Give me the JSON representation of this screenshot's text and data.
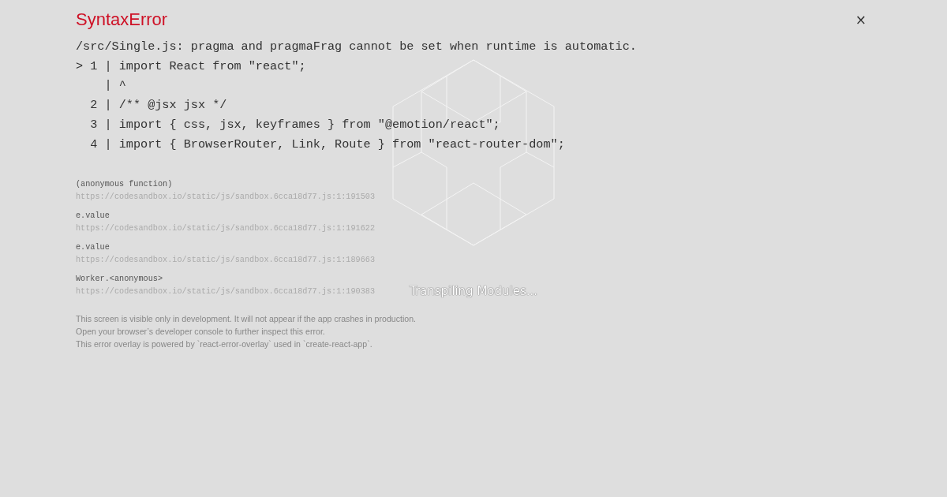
{
  "loader": {
    "status": "Transpiling Modules..."
  },
  "error": {
    "title": "SyntaxError",
    "close": "×",
    "message": "/src/Single.js: pragma and pragmaFrag cannot be set when runtime is automatic.",
    "code_lines": [
      "> 1 | import React from \"react\";",
      "    | ^",
      "  2 | /** @jsx jsx */",
      "  3 | import { css, jsx, keyframes } from \"@emotion/react\";",
      "  4 | import { BrowserRouter, Link, Route } from \"react-router-dom\";"
    ]
  },
  "stack_frames": [
    {
      "function": "(anonymous function)",
      "location": "https://codesandbox.io/static/js/sandbox.6cca18d77.js:1:191503"
    },
    {
      "function": "e.value",
      "location": "https://codesandbox.io/static/js/sandbox.6cca18d77.js:1:191622"
    },
    {
      "function": "e.value",
      "location": "https://codesandbox.io/static/js/sandbox.6cca18d77.js:1:189663"
    },
    {
      "function": "Worker.<anonymous>",
      "location": "https://codesandbox.io/static/js/sandbox.6cca18d77.js:1:190383"
    }
  ],
  "footer": [
    "This screen is visible only in development. It will not appear if the app crashes in production.",
    "Open your browser’s developer console to further inspect this error.",
    "This error overlay is powered by `react-error-overlay` used in `create-react-app`."
  ]
}
